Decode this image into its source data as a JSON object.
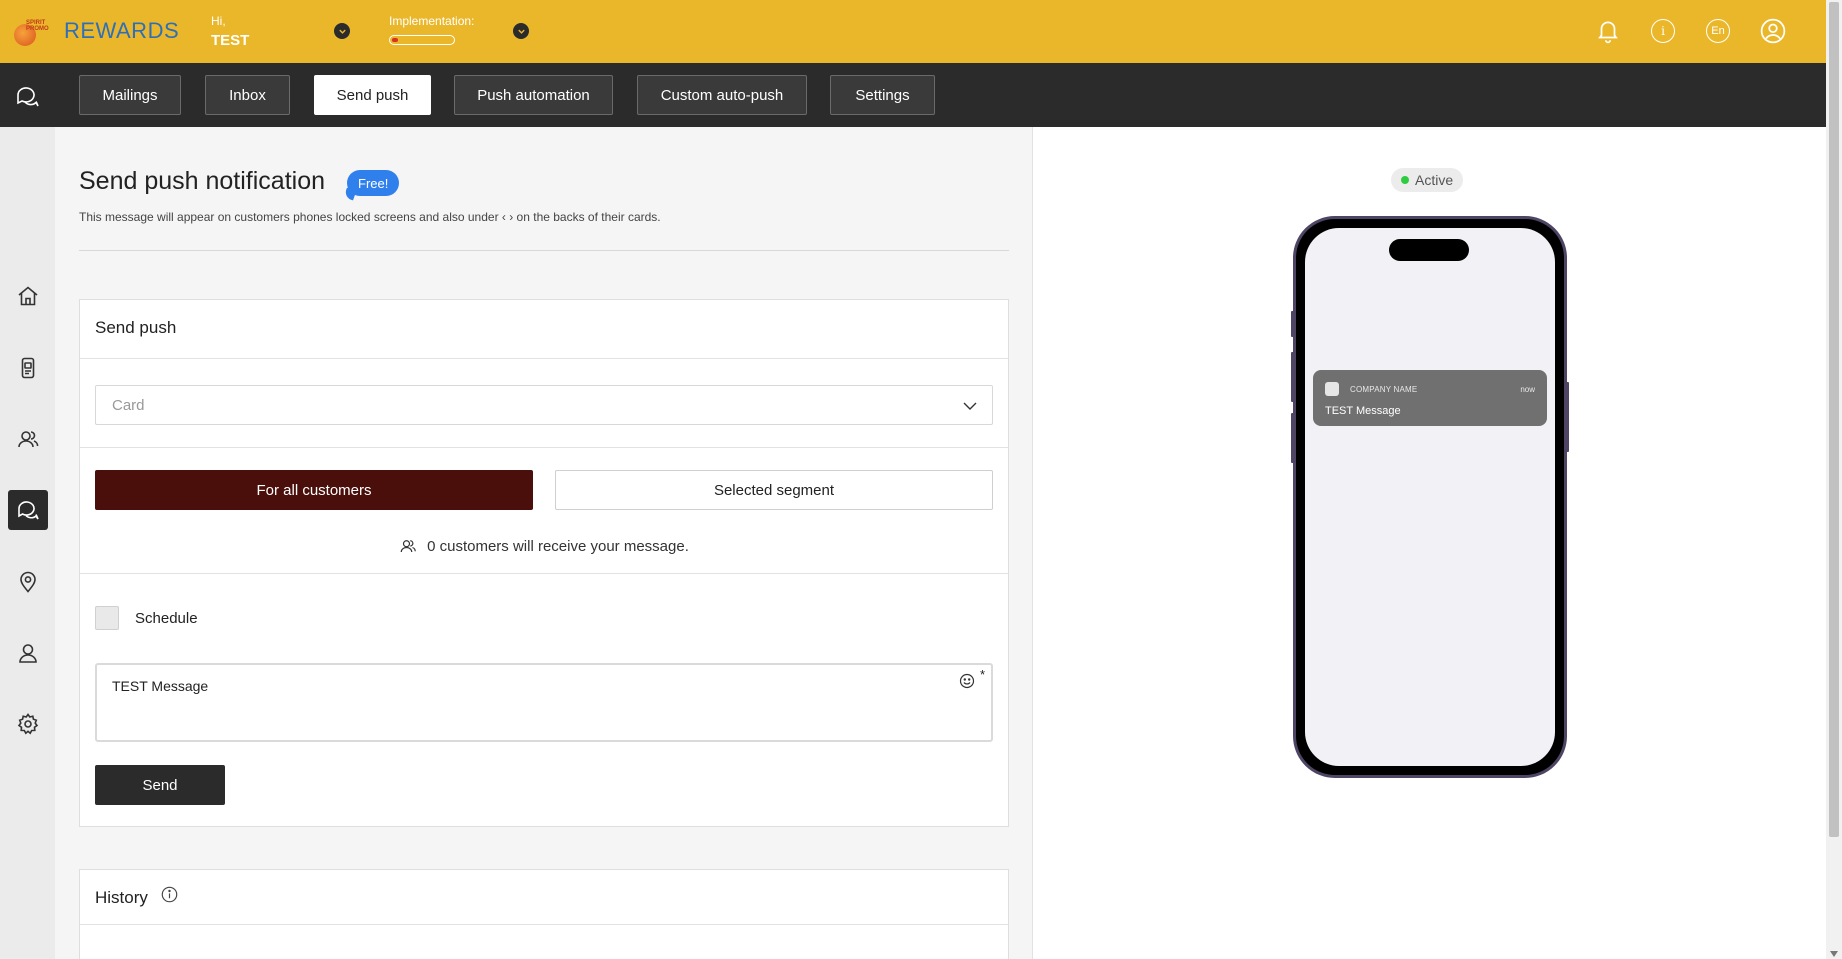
{
  "header": {
    "logo_text": "REWARDS",
    "greeting": "Hi,",
    "user_name": "TEST",
    "implementation_label": "Implementation:",
    "implementation_progress": 0.1,
    "language": "En",
    "colors": {
      "bar": "#ebb72a",
      "progress": "#d93025"
    }
  },
  "nav": {
    "tabs": [
      {
        "label": "Mailings",
        "active": false
      },
      {
        "label": "Inbox",
        "active": false
      },
      {
        "label": "Send push",
        "active": true
      },
      {
        "label": "Push automation",
        "active": false
      },
      {
        "label": "Custom auto-push",
        "active": false
      },
      {
        "label": "Settings",
        "active": false
      }
    ]
  },
  "sidebar": {
    "items": [
      {
        "icon": "home-icon"
      },
      {
        "icon": "phone-card-icon"
      },
      {
        "icon": "customers-icon"
      },
      {
        "icon": "chat-icon",
        "active": true
      },
      {
        "icon": "location-pin-icon"
      },
      {
        "icon": "user-icon"
      },
      {
        "icon": "gear-icon"
      }
    ]
  },
  "page": {
    "title": "Send push notification",
    "badge": "Free!",
    "subtitle": "This message will appear on customers phones locked screens and also under ‹ › on the backs of their cards."
  },
  "send_push": {
    "title": "Send push",
    "card_placeholder": "Card",
    "all_customers_label": "For all customers",
    "segment_label": "Selected segment",
    "recipients_text": "0 customers will receive your message.",
    "schedule_label": "Schedule",
    "message_value": "TEST Message",
    "required_mark": "*",
    "send_label": "Send"
  },
  "history": {
    "title": "History"
  },
  "preview": {
    "status": "Active",
    "company_name": "COMPANY NAME",
    "time": "now",
    "message": "TEST Message"
  }
}
